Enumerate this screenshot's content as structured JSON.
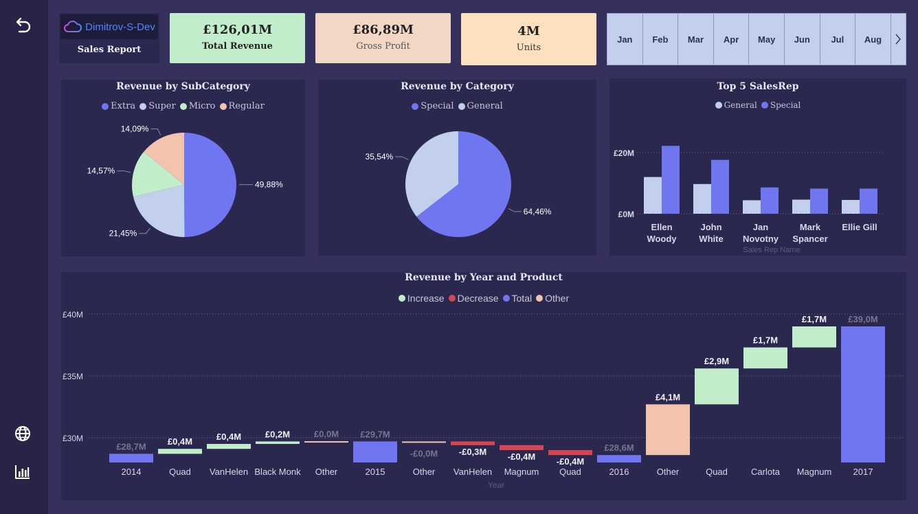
{
  "logo": {
    "brand": "Dimitrov-S-Dev",
    "subtitle": "Sales Report"
  },
  "kpis": [
    {
      "value": "£126,01M",
      "label": "Total Revenue",
      "bg": "#c2edcb"
    },
    {
      "value": "£86,89M",
      "label": "Gross Profit",
      "bg": "#f3d7c6"
    },
    {
      "value": "4M",
      "label": "Units",
      "bg": "#fde1bf"
    }
  ],
  "months": [
    "Jan",
    "Feb",
    "Mar",
    "Apr",
    "May",
    "Jun",
    "Jul",
    "Aug"
  ],
  "colors": {
    "special": "#7075f0",
    "general": "#c2d0ee",
    "micro": "#c2edcb",
    "regular": "#f3c4ad",
    "decrease": "#d64550",
    "other": "#f3c4ad"
  },
  "subcategory": {
    "title": "Revenue by SubCategory",
    "legend": [
      "Extra",
      "Super",
      "Micro",
      "Regular"
    ]
  },
  "category": {
    "title": "Revenue by Category",
    "legend": [
      "Special",
      "General"
    ]
  },
  "salesrep": {
    "title": "Top 5 SalesRep",
    "legend": [
      "General",
      "Special"
    ],
    "xlabel": "Sales Rep Name"
  },
  "waterfall": {
    "title": "Revenue by Year and Product",
    "legend": [
      "Increase",
      "Decrease",
      "Total",
      "Other"
    ],
    "xlabel": "Year"
  },
  "chart_data": [
    {
      "type": "pie",
      "title": "Revenue by SubCategory",
      "labels": [
        "Extra",
        "Super",
        "Micro",
        "Regular"
      ],
      "values": [
        49.88,
        21.45,
        14.57,
        14.09
      ],
      "value_labels": [
        "49,88%",
        "21,45%",
        "14,57%",
        "14,09%"
      ]
    },
    {
      "type": "pie",
      "title": "Revenue by Category",
      "labels": [
        "Special",
        "General"
      ],
      "values": [
        64.46,
        35.54
      ],
      "value_labels": [
        "64,46%",
        "35,54%"
      ]
    },
    {
      "type": "bar",
      "title": "Top 5 SalesRep",
      "categories": [
        "Ellen Woody",
        "John White",
        "Jan Novotny",
        "Mark Spancer",
        "Ellie Gill"
      ],
      "category_lines": [
        [
          "Ellen",
          "Woody"
        ],
        [
          "John",
          "White"
        ],
        [
          "Jan",
          "Novotny"
        ],
        [
          "Mark",
          "Spancer"
        ],
        [
          "Ellie Gill"
        ]
      ],
      "series": [
        {
          "name": "General",
          "values": [
            12,
            9.7,
            4.4,
            4.6,
            4.5
          ]
        },
        {
          "name": "Special",
          "values": [
            22.2,
            17.6,
            8.6,
            8.2,
            8.2
          ]
        }
      ],
      "y_ticks": [
        0,
        20
      ],
      "y_tick_labels": [
        "£0M",
        "£20M"
      ],
      "ylim": [
        0,
        25
      ],
      "xlabel": "Sales Rep Name"
    },
    {
      "type": "bar",
      "subtype": "waterfall",
      "title": "Revenue by Year and Product",
      "y_ticks": [
        30,
        35,
        40
      ],
      "y_tick_labels": [
        "£30M",
        "£35M",
        "£40M"
      ],
      "ylim": [
        28,
        40
      ],
      "xlabel": "Year",
      "bars": [
        {
          "label": "2014",
          "kind": "total",
          "start": 28,
          "end": 28.7,
          "text": "£28,7M"
        },
        {
          "label": "Quad",
          "kind": "increase",
          "start": 28.7,
          "end": 29.1,
          "text": "£0,4M"
        },
        {
          "label": "VanHelen",
          "kind": "increase",
          "start": 29.1,
          "end": 29.5,
          "text": "£0,4M"
        },
        {
          "label": "Black Monk",
          "kind": "increase",
          "start": 29.5,
          "end": 29.7,
          "text": "£0,2M"
        },
        {
          "label": "Other",
          "kind": "other",
          "start": 29.7,
          "end": 29.72,
          "text": "£0,0M"
        },
        {
          "label": "2015",
          "kind": "total",
          "start": 28,
          "end": 29.7,
          "text": "£29,7M"
        },
        {
          "label": "Other",
          "kind": "other",
          "start": 29.7,
          "end": 29.68,
          "text": "-£0,0M"
        },
        {
          "label": "VanHelen",
          "kind": "decrease",
          "start": 29.7,
          "end": 29.4,
          "text": "-£0,3M"
        },
        {
          "label": "Magnum",
          "kind": "decrease",
          "start": 29.4,
          "end": 29.0,
          "text": "-£0,4M"
        },
        {
          "label": "Quad",
          "kind": "decrease",
          "start": 29.0,
          "end": 28.6,
          "text": "-£0,4M"
        },
        {
          "label": "2016",
          "kind": "total",
          "start": 28,
          "end": 28.6,
          "text": "£28,6M"
        },
        {
          "label": "Other",
          "kind": "other",
          "start": 28.6,
          "end": 32.7,
          "text": "£4,1M"
        },
        {
          "label": "Quad",
          "kind": "increase",
          "start": 32.7,
          "end": 35.6,
          "text": "£2,9M"
        },
        {
          "label": "Carlota",
          "kind": "increase",
          "start": 35.6,
          "end": 37.3,
          "text": "£1,7M"
        },
        {
          "label": "Magnum",
          "kind": "increase",
          "start": 37.3,
          "end": 39.0,
          "text": "£1,7M"
        },
        {
          "label": "2017",
          "kind": "total",
          "start": 28,
          "end": 39.0,
          "text": "£39,0M"
        }
      ]
    }
  ]
}
